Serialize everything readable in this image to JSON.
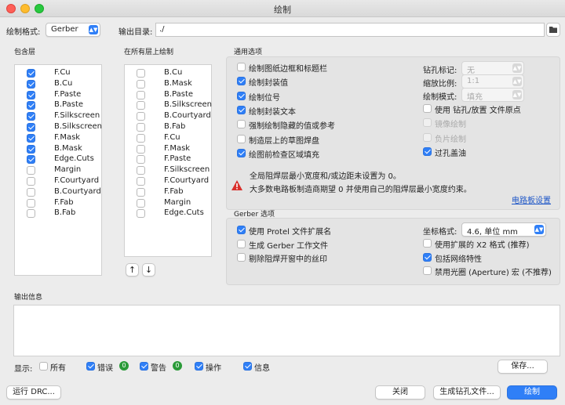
{
  "window": {
    "title": "绘制"
  },
  "top": {
    "format_label": "绘制格式:",
    "format_value": "Gerber",
    "outdir_label": "输出目录:",
    "outdir_value": "./"
  },
  "include_layers": {
    "header": "包含层",
    "items": [
      {
        "label": "F.Cu",
        "checked": true
      },
      {
        "label": "B.Cu",
        "checked": true
      },
      {
        "label": "F.Paste",
        "checked": true
      },
      {
        "label": "B.Paste",
        "checked": true
      },
      {
        "label": "F.Silkscreen",
        "checked": true
      },
      {
        "label": "B.Silkscreen",
        "checked": true
      },
      {
        "label": "F.Mask",
        "checked": true
      },
      {
        "label": "B.Mask",
        "checked": true
      },
      {
        "label": "Edge.Cuts",
        "checked": true
      },
      {
        "label": "Margin",
        "checked": false
      },
      {
        "label": "F.Courtyard",
        "checked": false
      },
      {
        "label": "B.Courtyard",
        "checked": false
      },
      {
        "label": "F.Fab",
        "checked": false
      },
      {
        "label": "B.Fab",
        "checked": false
      }
    ]
  },
  "all_layers": {
    "header": "在所有层上绘制",
    "items": [
      {
        "label": "B.Cu",
        "checked": false
      },
      {
        "label": "B.Mask",
        "checked": false
      },
      {
        "label": "B.Paste",
        "checked": false
      },
      {
        "label": "B.Silkscreen",
        "checked": false
      },
      {
        "label": "B.Courtyard",
        "checked": false
      },
      {
        "label": "B.Fab",
        "checked": false
      },
      {
        "label": "F.Cu",
        "checked": false
      },
      {
        "label": "F.Mask",
        "checked": false
      },
      {
        "label": "F.Paste",
        "checked": false
      },
      {
        "label": "F.Silkscreen",
        "checked": false
      },
      {
        "label": "F.Courtyard",
        "checked": false
      },
      {
        "label": "F.Fab",
        "checked": false
      },
      {
        "label": "Margin",
        "checked": false
      },
      {
        "label": "Edge.Cuts",
        "checked": false
      }
    ],
    "up_arrow": "↑",
    "down_arrow": "↓"
  },
  "general": {
    "header": "通用选项",
    "left": [
      {
        "label": "绘制图纸边框和标题栏",
        "checked": false
      },
      {
        "label": "绘制封装值",
        "checked": true
      },
      {
        "label": "绘制位号",
        "checked": true
      },
      {
        "label": "绘制封装文本",
        "checked": true
      },
      {
        "label": "强制绘制隐藏的值或参考",
        "checked": false
      },
      {
        "label": "制造层上的草图焊盘",
        "checked": false
      },
      {
        "label": "绘图前检查区域填充",
        "checked": true
      }
    ],
    "drill_label": "钻孔标记:",
    "drill_value": "无",
    "scale_label": "缩放比例:",
    "scale_value": "1:1",
    "mode_label": "绘制模式:",
    "mode_value": "填充",
    "right_checks": [
      {
        "label": "使用 钻孔/放置 文件原点",
        "checked": false,
        "disabled": false
      },
      {
        "label": "镜像绘制",
        "checked": false,
        "disabled": true
      },
      {
        "label": "负片绘制",
        "checked": false,
        "disabled": true
      },
      {
        "label": "过孔盖油",
        "checked": true,
        "disabled": false
      }
    ],
    "warning_line1": "全局阻焊层最小宽度和/或边距未设置为 0。",
    "warning_line2": "大多数电路板制造商期望 0 并使用自己的阻焊层最小宽度约束。",
    "board_setup_link": "电路板设置"
  },
  "gerber": {
    "header": "Gerber 选项",
    "left": [
      {
        "label": "使用 Protel 文件扩展名",
        "checked": true
      },
      {
        "label": "生成 Gerber 工作文件",
        "checked": false
      },
      {
        "label": "剔除阻焊开窗中的丝印",
        "checked": false
      }
    ],
    "coord_label": "坐标格式:",
    "coord_value": "4.6, 单位 mm",
    "right_checks": [
      {
        "label": "使用扩展的 X2 格式 (推荐)",
        "checked": false
      },
      {
        "label": "包括网络特性",
        "checked": true
      },
      {
        "label": "禁用光圈 (Aperture) 宏 (不推荐)",
        "checked": false
      }
    ]
  },
  "output": {
    "header": "输出信息",
    "show_label": "显示:",
    "filters": [
      {
        "label": "所有",
        "checked": false,
        "badge": null
      },
      {
        "label": "错误",
        "checked": true,
        "badge": "0"
      },
      {
        "label": "警告",
        "checked": true,
        "badge": "0"
      },
      {
        "label": "操作",
        "checked": true,
        "badge": null
      },
      {
        "label": "信息",
        "checked": true,
        "badge": null
      }
    ],
    "save_label": "保存..."
  },
  "bottom": {
    "drc_label": "运行 DRC...",
    "close_label": "关闭",
    "drill_files_label": "生成钻孔文件...",
    "plot_label": "绘制"
  },
  "colors": {
    "accent": "#2f7ff7",
    "badge_green": "#2a9a38",
    "link": "#1c55c7",
    "warning": "#d9302c"
  }
}
